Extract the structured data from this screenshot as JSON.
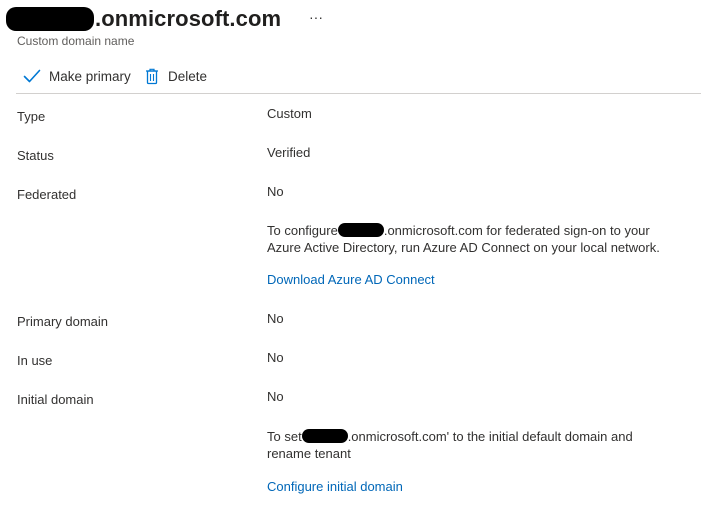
{
  "header": {
    "title_suffix": ".onmicrosoft.com",
    "more_label": "···",
    "subtitle": "Custom domain name"
  },
  "toolbar": {
    "make_primary_label": "Make primary",
    "make_primary_icon": "checkmark-icon",
    "delete_label": "Delete",
    "delete_icon": "trash-icon",
    "icon_color": "#0078d4"
  },
  "details": {
    "type": {
      "label": "Type",
      "value": "Custom"
    },
    "status": {
      "label": "Status",
      "value": "Verified"
    },
    "federated": {
      "label": "Federated",
      "value": "No",
      "info_prefix": "To configure",
      "info_suffix": ".onmicrosoft.com for federated sign-on to your",
      "info_line2": "Azure Active Directory, run Azure AD Connect on your local network.",
      "link": "Download Azure AD Connect"
    },
    "primary_domain": {
      "label": "Primary domain",
      "value": "No"
    },
    "in_use": {
      "label": "In use",
      "value": "No"
    },
    "initial_domain": {
      "label": "Initial domain",
      "value": "No",
      "info_prefix": "To set",
      "info_suffix": ".onmicrosoft.com' to the initial default domain and",
      "info_line2": "rename tenant",
      "link": "Configure initial domain"
    }
  },
  "colors": {
    "link": "#0067b8",
    "text": "#323130",
    "subtle_text": "#605e5c",
    "divider": "#d2d0ce"
  }
}
